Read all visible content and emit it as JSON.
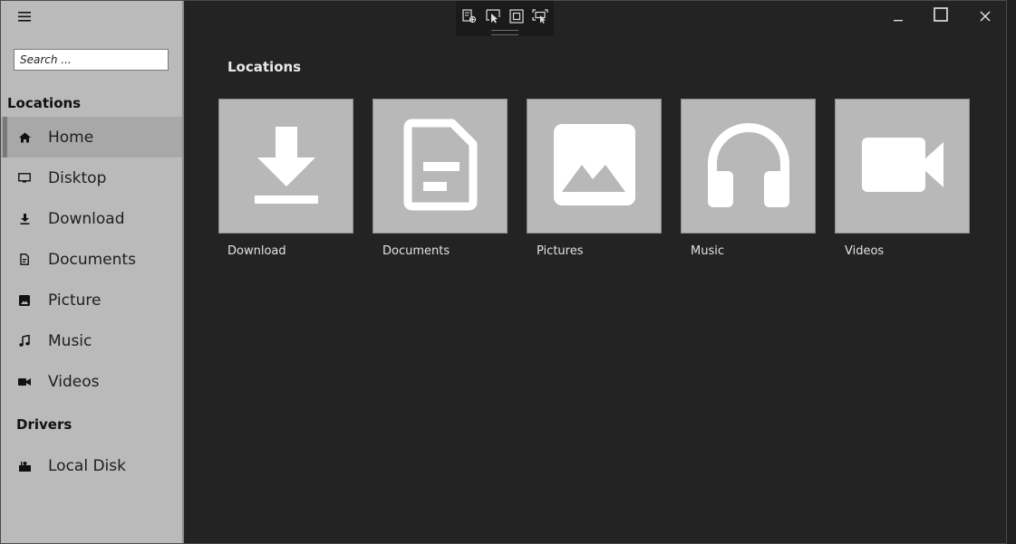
{
  "sidebar": {
    "search_placeholder": "Search ...",
    "locations_heading": "Locations",
    "drivers_heading": "Drivers",
    "items": [
      {
        "label": "Home",
        "icon": "home-icon"
      },
      {
        "label": "Disktop",
        "icon": "monitor-icon"
      },
      {
        "label": "Download",
        "icon": "download-icon"
      },
      {
        "label": "Documents",
        "icon": "document-icon"
      },
      {
        "label": "Picture",
        "icon": "picture-icon"
      },
      {
        "label": "Music",
        "icon": "music-note-icon"
      },
      {
        "label": "Videos",
        "icon": "video-camera-icon"
      }
    ],
    "drives": [
      {
        "label": "Local Disk",
        "icon": "disk-icon"
      }
    ],
    "active_item": "Home"
  },
  "main": {
    "title": "Locations",
    "tiles": [
      {
        "label": "Download",
        "icon": "download-icon"
      },
      {
        "label": "Documents",
        "icon": "document-icon"
      },
      {
        "label": "Pictures",
        "icon": "picture-icon"
      },
      {
        "label": "Music",
        "icon": "headphones-icon"
      },
      {
        "label": "Videos",
        "icon": "video-camera-icon"
      }
    ]
  },
  "devtools": [
    "live-visual-tree-icon",
    "select-element-icon",
    "display-layout-adorners-icon",
    "track-focus-icon"
  ],
  "window_controls": [
    "minimize-icon",
    "maximize-icon",
    "close-icon"
  ],
  "colors": {
    "sidebar_bg": "#bababa",
    "content_bg": "#232323",
    "tile_bg": "#b8b8b8",
    "icon_white": "#ffffff"
  }
}
